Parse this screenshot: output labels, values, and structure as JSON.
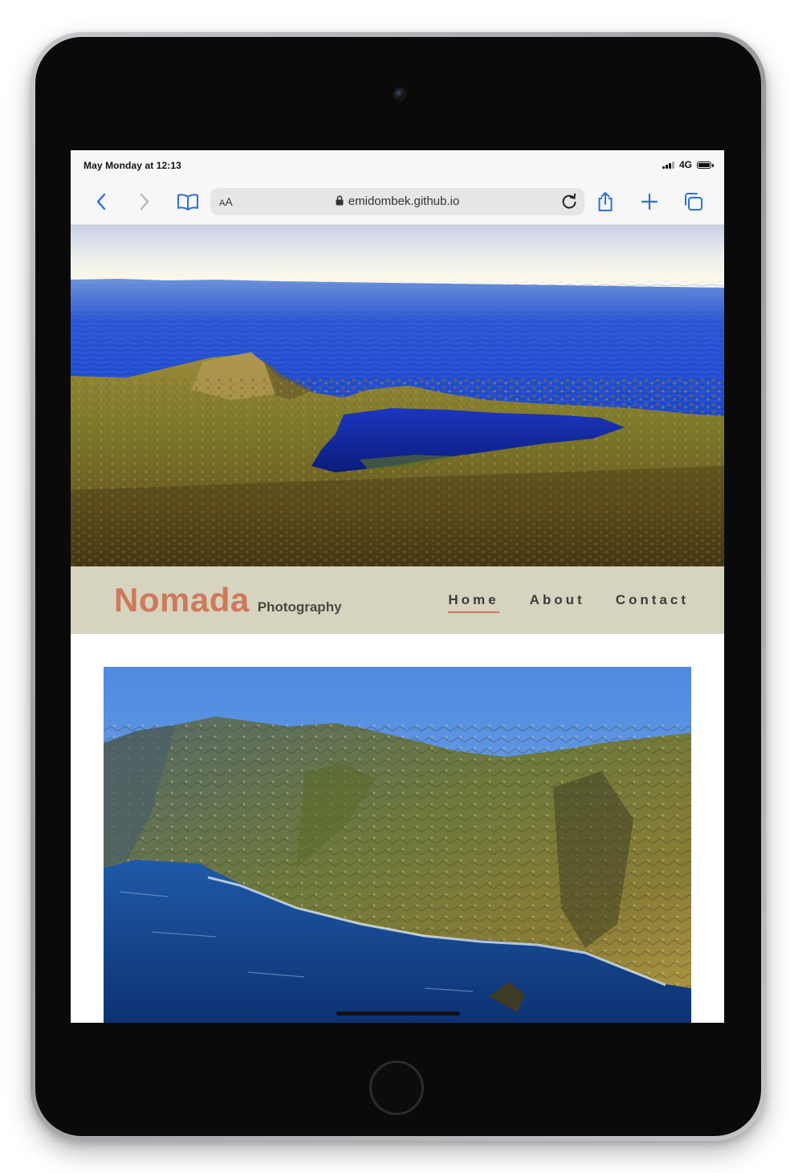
{
  "status_bar": {
    "time": "May Monday at 12:13",
    "network": "4G"
  },
  "browser": {
    "text_size_label_small": "A",
    "text_size_label_large": "A",
    "url": "emidombek.github.io",
    "icons": {
      "back": "chevron-left-icon",
      "forward": "chevron-right-icon",
      "bookmarks": "book-icon",
      "lock": "lock-icon",
      "reload": "reload-icon",
      "share": "share-icon",
      "new_tab": "plus-icon",
      "tabs": "tabs-icon"
    },
    "accent_color": "#2f6fdf"
  },
  "site": {
    "brand_name": "Nomada",
    "brand_tagline": "Photography",
    "nav": [
      {
        "label": "Home",
        "active": true
      },
      {
        "label": "About",
        "active": false
      },
      {
        "label": "Contact",
        "active": false
      }
    ],
    "colors": {
      "brand": "#cc7a5c",
      "nav_background": "#d6d3bf",
      "nav_text": "#3e3d38"
    }
  },
  "images": {
    "hero": "coastal-lake-landscape-photo",
    "content": "sea-cliffs-landscape-photo"
  }
}
